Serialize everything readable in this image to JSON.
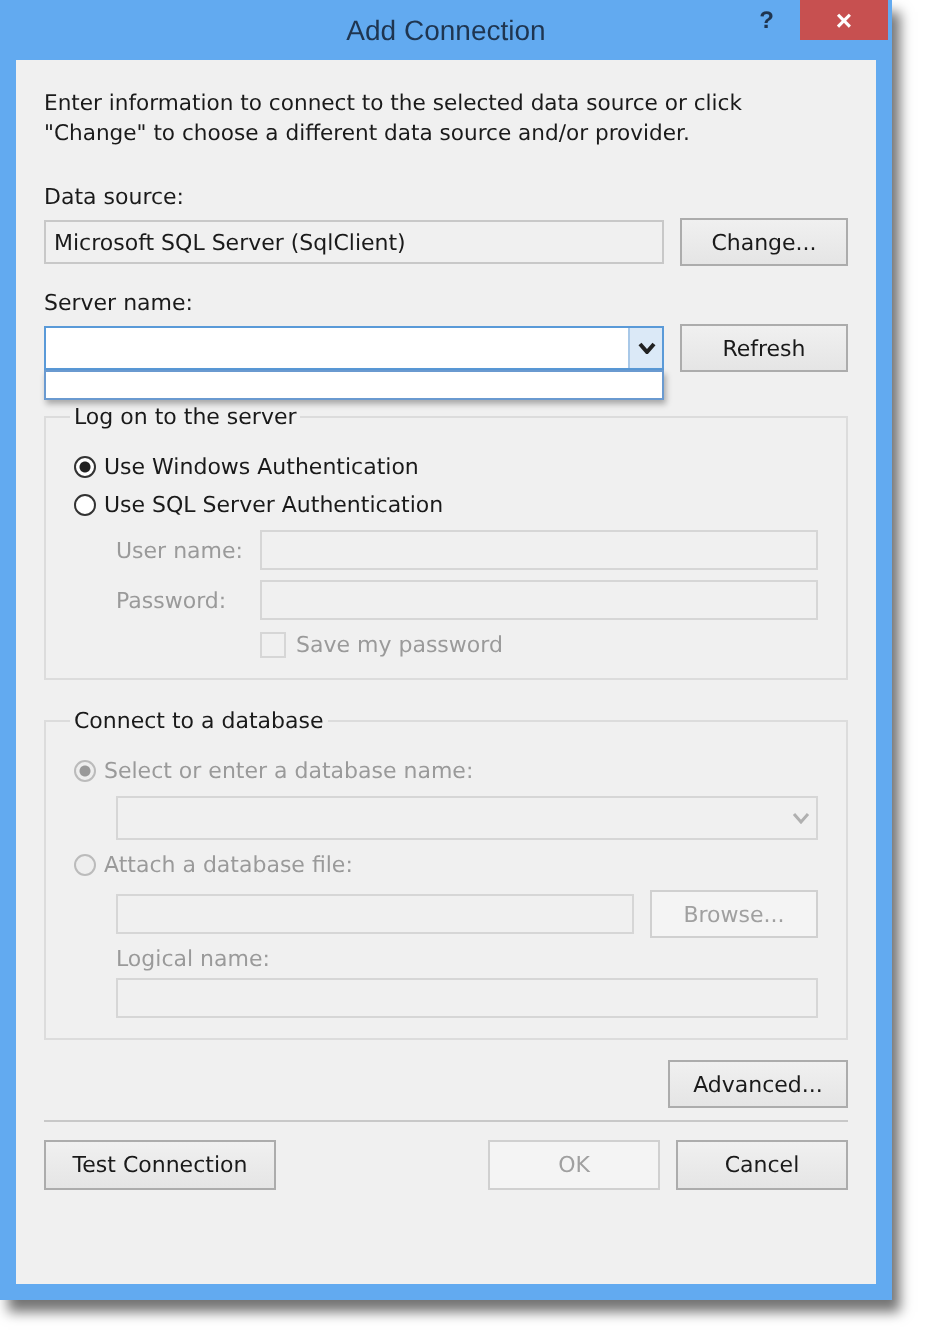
{
  "window": {
    "title": "Add Connection",
    "help_button": "?",
    "close_button": "×"
  },
  "description": "Enter information to connect to the selected data source or click \"Change\" to choose a different data source and/or provider.",
  "data_source": {
    "label": "Data source:",
    "value": "Microsoft SQL Server (SqlClient)",
    "button": "Change..."
  },
  "server_name": {
    "label": "Server name:",
    "expanded": true,
    "button": "Refresh"
  },
  "logon_group": {
    "title": "Log on to the server",
    "options": [
      {
        "label": "Use Windows Authentication",
        "selected": true
      },
      {
        "label": "Use SQL Server Authentication",
        "selected": false
      }
    ],
    "fields": [
      {
        "label": "User name:",
        "disabled": true
      },
      {
        "label": "Password:",
        "disabled": true
      }
    ],
    "save_password": {
      "label": "Save my password",
      "checked": false,
      "disabled": true
    }
  },
  "database_group": {
    "title": "Connect to a database",
    "select_option": {
      "label": "Select or enter a database name:",
      "selected": true,
      "disabled": true
    },
    "database_combo": {
      "disabled": true
    },
    "attach_option": {
      "label": "Attach a database file:",
      "selected": false,
      "disabled": true
    },
    "browse_button": {
      "label": "Browse...",
      "disabled": true
    },
    "logical_name": {
      "label": "Logical name:",
      "disabled": true
    }
  },
  "advanced_button": "Advanced...",
  "buttons": [
    {
      "label": "Test Connection",
      "disabled": false
    },
    {
      "label": "OK",
      "disabled": true
    },
    {
      "label": "Cancel",
      "disabled": false
    }
  ]
}
